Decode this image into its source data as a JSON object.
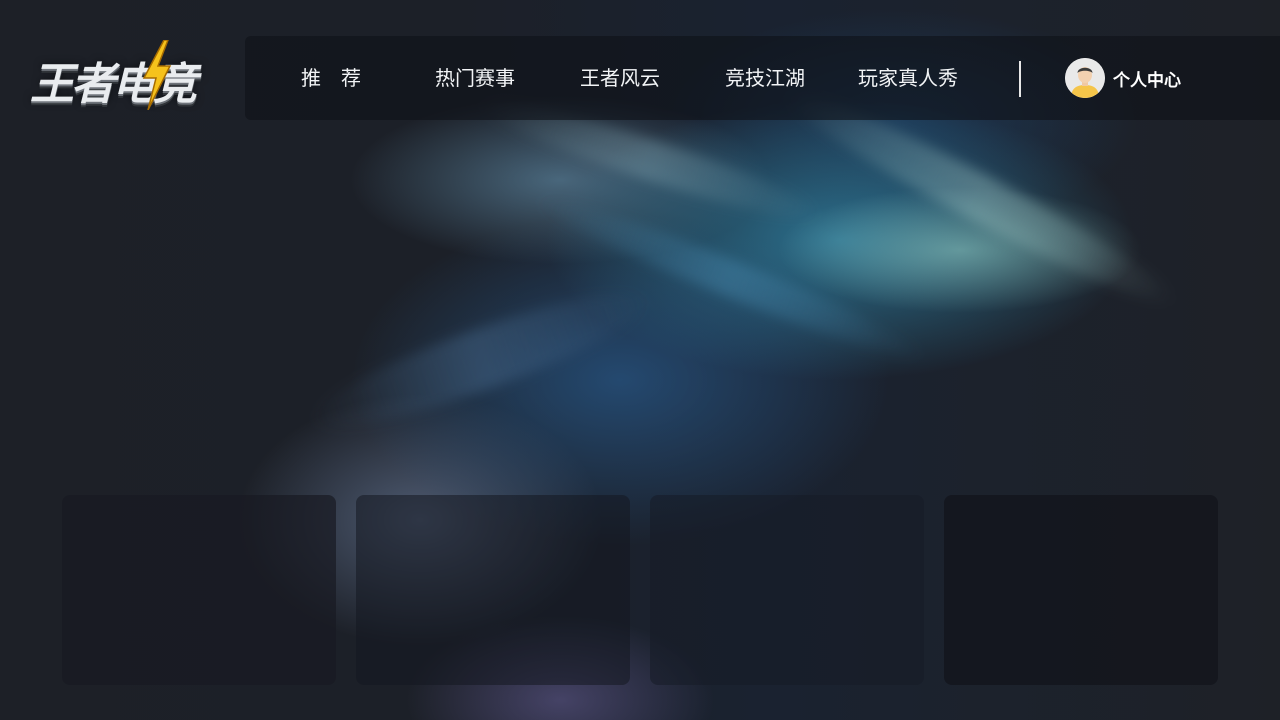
{
  "logo": {
    "text": "王者电竞",
    "icon": "lightning-bolt-icon"
  },
  "nav": {
    "items": [
      {
        "label": "推　荐"
      },
      {
        "label": "热门赛事"
      },
      {
        "label": "王者风云"
      },
      {
        "label": "竞技江湖"
      },
      {
        "label": "玩家真人秀"
      }
    ],
    "profile_label": "个人中心",
    "profile_icon": "user-avatar-icon"
  },
  "colors": {
    "nav_text": "#f2f4f6",
    "bolt_yellow": "#f6c21c",
    "avatar_shirt": "#f5c54a"
  },
  "cards": [
    {
      "label": ""
    },
    {
      "label": ""
    },
    {
      "label": ""
    },
    {
      "label": ""
    }
  ]
}
